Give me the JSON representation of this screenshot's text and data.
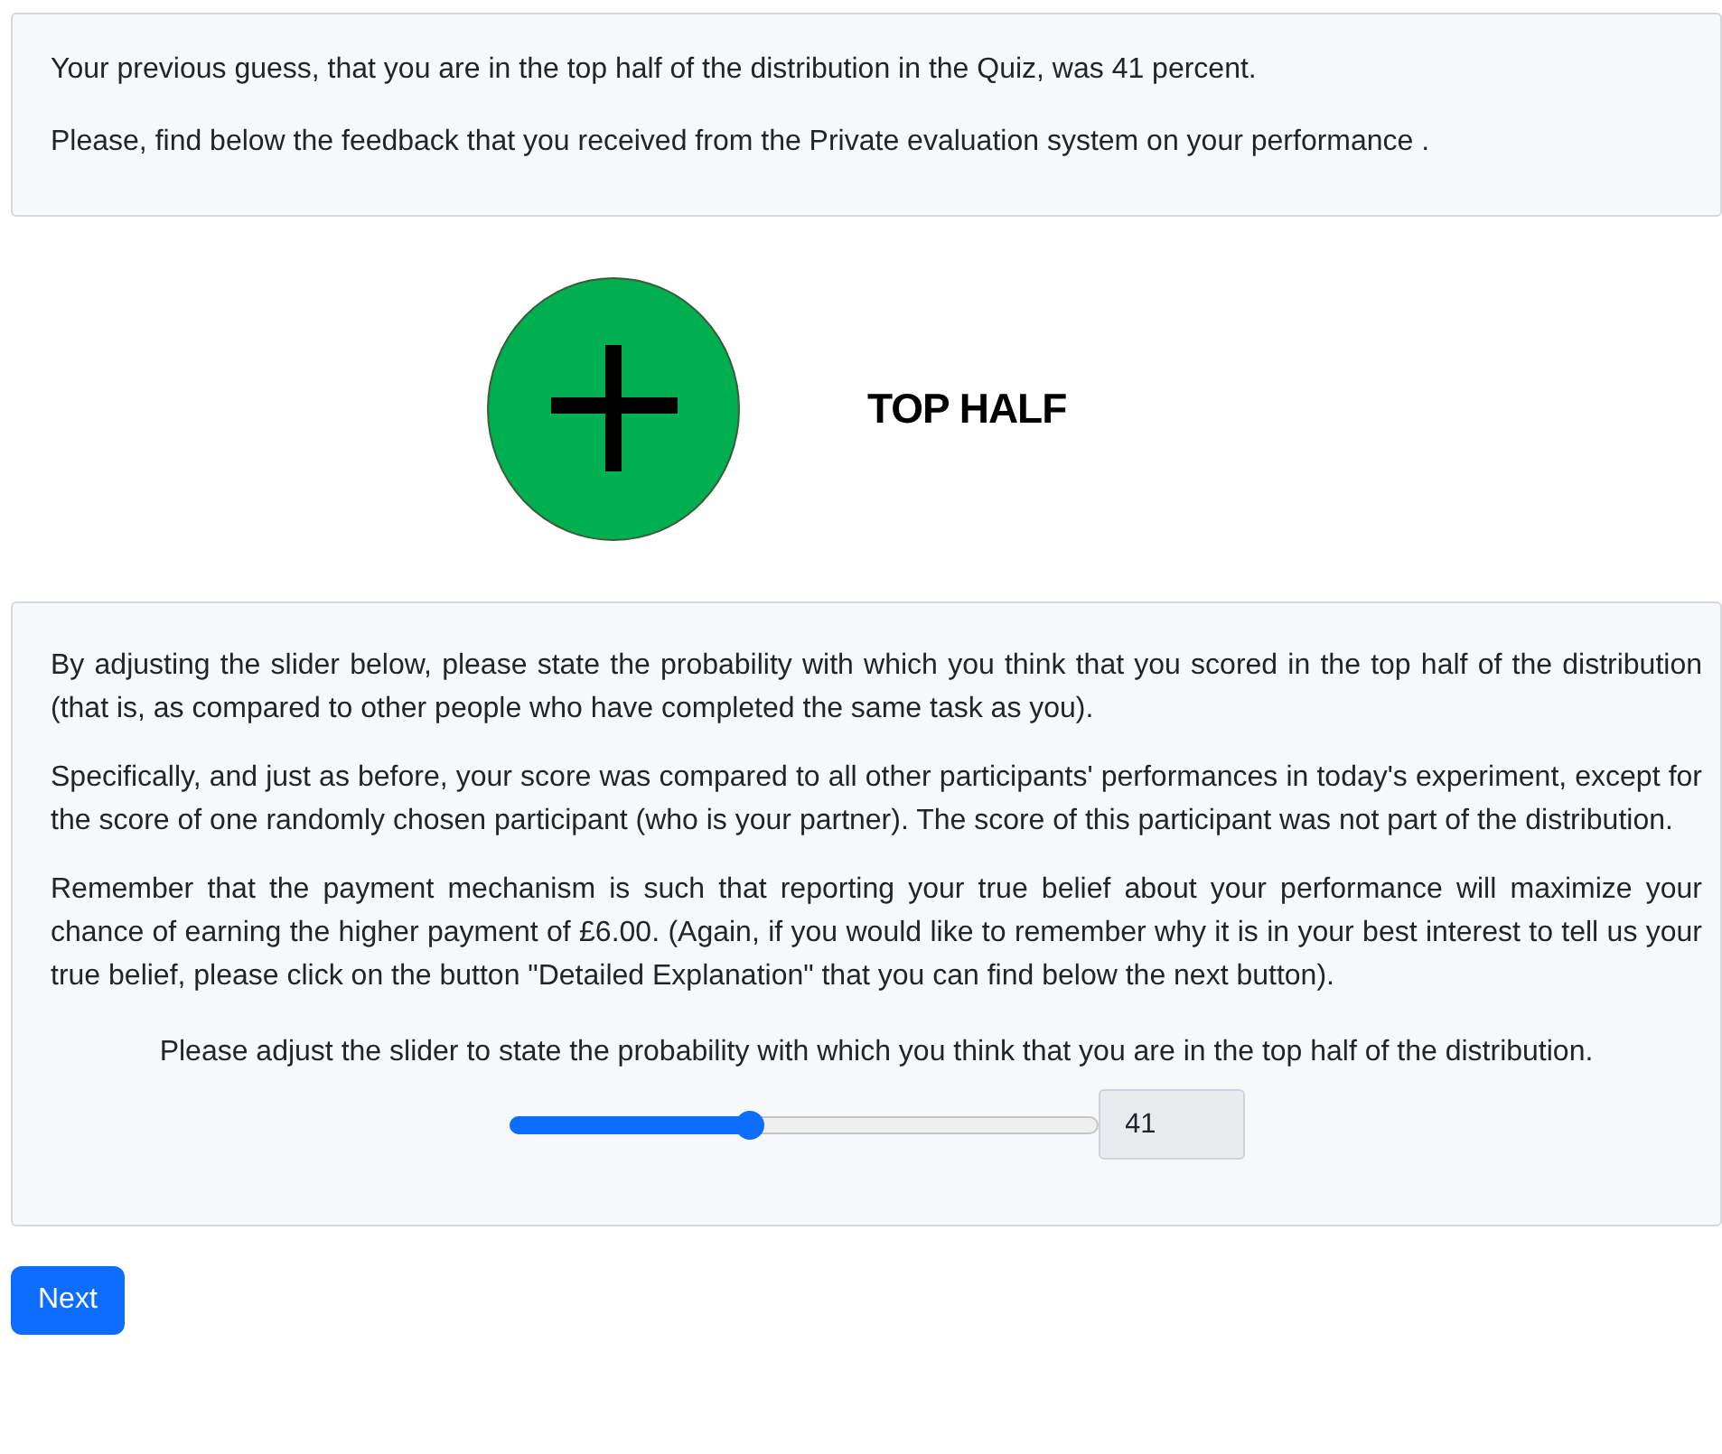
{
  "intro": [
    "Your previous guess, that you are in the top half of the distribution in the Quiz, was 41 percent.",
    "Please, find below the feedback that you received from the Private evaluation system on your performance ."
  ],
  "feedback": {
    "kind": "positive",
    "label": "TOP HALF"
  },
  "question": {
    "paragraphs": [
      "By adjusting the slider below, please state the probability with which you think that you scored in the top half of the distribution (that is, as compared to other people who have completed the same task as you).",
      "Specifically, and just as before, your score was compared to all other participants' performances in today's experiment, except for the score of one randomly chosen participant (who is your partner). The score of this participant was not part of the distribution.",
      "Remember that the payment mechanism is such that reporting your true belief about your performance will maximize your chance of earning the higher payment of £6.00. (Again, if you would like to remember why it is in your best interest to tell us your true belief, please click on the button \"Detailed Explanation\" that you can find below the next button)."
    ],
    "slider_prompt": "Please adjust the slider to state the probability with which you think that you are in the top half of the distribution.",
    "slider": {
      "level": 0.41
    },
    "value": "41"
  },
  "buttons": [
    {
      "label": "Next"
    }
  ]
}
